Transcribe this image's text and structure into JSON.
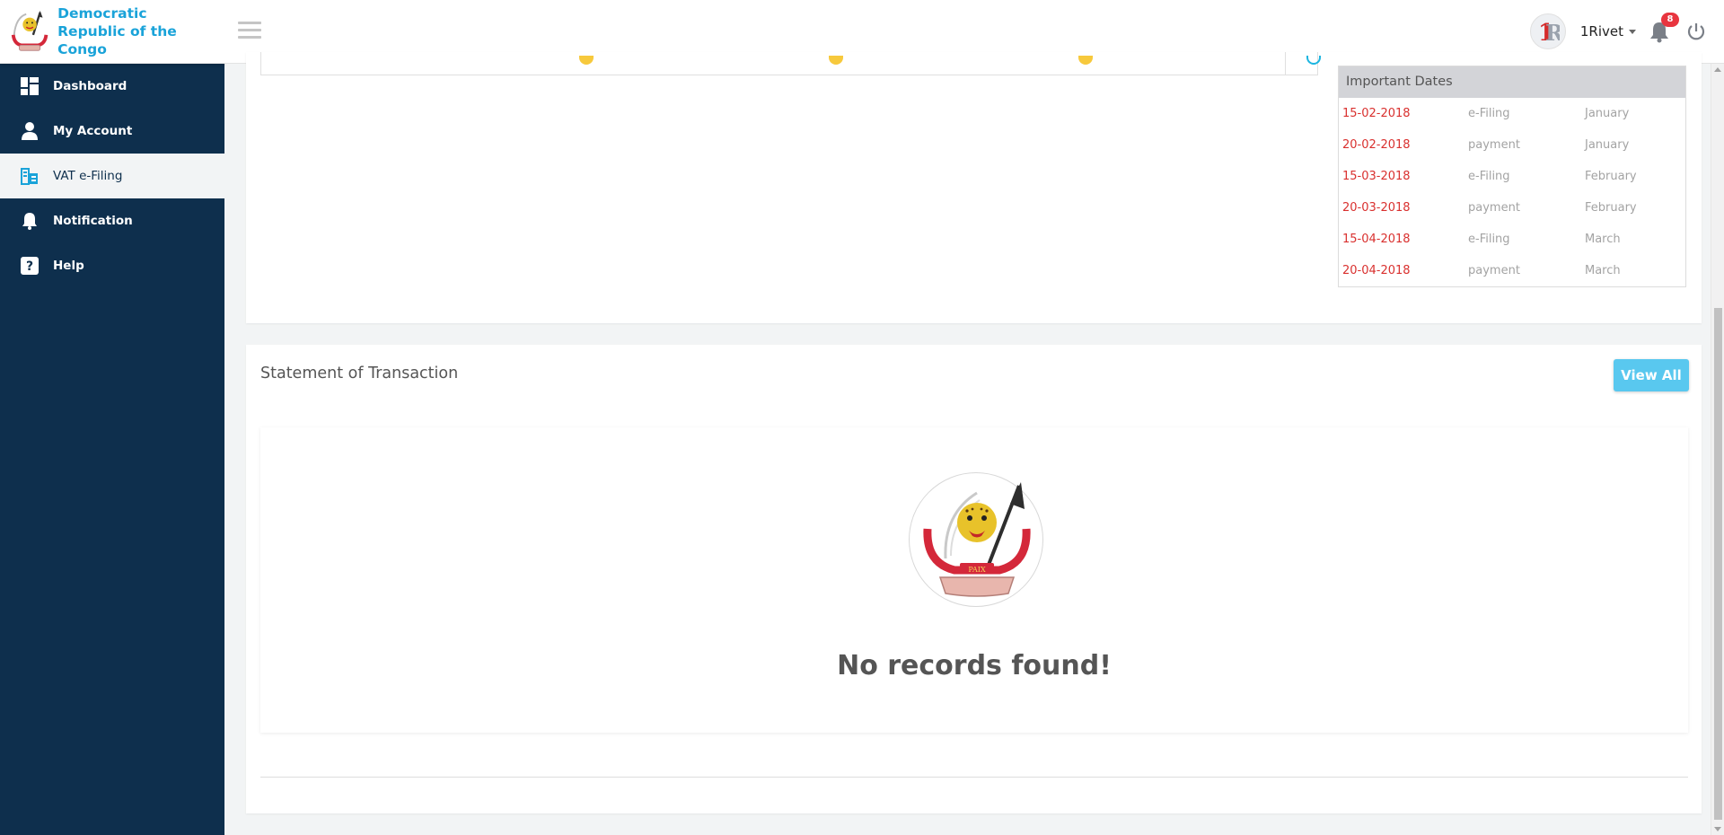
{
  "brand": {
    "line1": "Democratic",
    "line2": "Republic of the Congo"
  },
  "sidebar": {
    "items": [
      {
        "label": "Dashboard",
        "icon": "dashboard-grid-icon",
        "active": false
      },
      {
        "label": "My Account",
        "icon": "user-icon",
        "active": false
      },
      {
        "label": "VAT e-Filing",
        "icon": "vat-filing-icon",
        "active": true
      },
      {
        "label": "Notification",
        "icon": "bell-icon",
        "active": false
      },
      {
        "label": "Help",
        "icon": "help-icon",
        "active": false
      }
    ]
  },
  "header": {
    "user_name": "1Rivet",
    "notification_count": "8"
  },
  "important_dates": {
    "title": "Important Dates",
    "rows": [
      {
        "date": "15-02-2018",
        "type": "e-Filing",
        "month": "January"
      },
      {
        "date": "20-02-2018",
        "type": "payment",
        "month": "January"
      },
      {
        "date": "15-03-2018",
        "type": "e-Filing",
        "month": "February"
      },
      {
        "date": "20-03-2018",
        "type": "payment",
        "month": "February"
      },
      {
        "date": "15-04-2018",
        "type": "e-Filing",
        "month": "March"
      },
      {
        "date": "20-04-2018",
        "type": "payment",
        "month": "March"
      }
    ]
  },
  "statement": {
    "title": "Statement of Transaction",
    "view_all_label": "View All",
    "empty_message": "No records found!"
  },
  "colors": {
    "sidebar_bg": "#0e2f4d",
    "brand_text": "#1aa3d9",
    "accent_button": "#59c8ef",
    "date_red": "#d9302e",
    "badge_red": "#e8353f"
  }
}
